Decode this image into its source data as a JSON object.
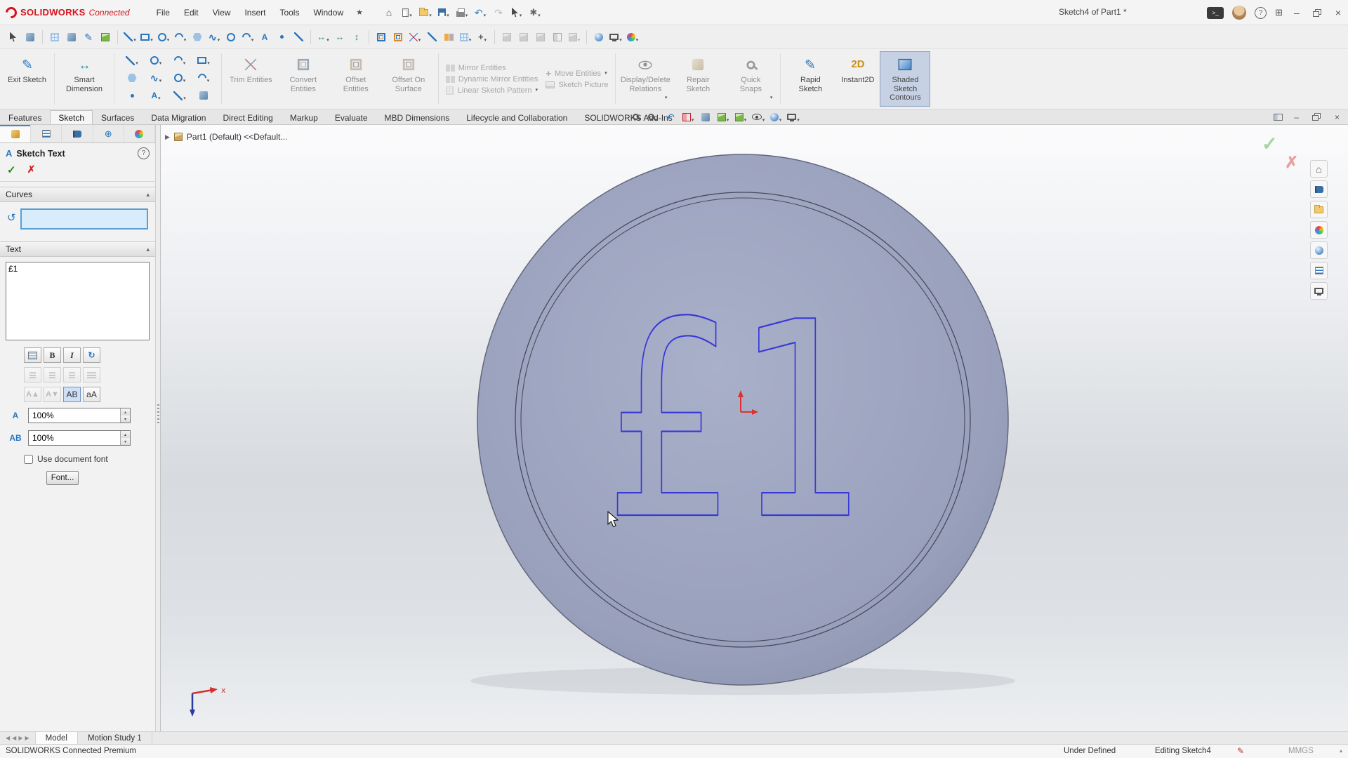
{
  "titlebar": {
    "logo_text": "SOLIDWORKS",
    "logo_sub": "Connected",
    "menus": [
      "File",
      "Edit",
      "View",
      "Insert",
      "Tools",
      "Window"
    ],
    "doc_title": "Sketch4 of Part1 *"
  },
  "icons": {
    "star": "★",
    "home": "⌂",
    "undo": "↶",
    "redo": "↷",
    "caret": "▾",
    "check": "✓",
    "cross": "✗",
    "help": "?",
    "minimize": "–",
    "close": "×",
    "terminal": ">_",
    "grid_view": "⊞",
    "chevron_up": "▴",
    "bold": "B",
    "italic": "I",
    "rotate": "↻",
    "curve": "↺",
    "width_factor": "A",
    "spacing": "AB",
    "ab_button": "AB",
    "aa_button": "aA",
    "pen": "✎",
    "flip_up": "A▲",
    "flip_down": "A▼",
    "breadcrumb_arrow": "▶",
    "tab_scroll_left": "◀",
    "tab_scroll_right": "▶",
    "spinner_up": "▴",
    "spinner_down": "▾",
    "pm_header": "A"
  },
  "icon_sets": {
    "titlebar_tools": [
      {
        "n": "home",
        "s": "home",
        "g": "⌂"
      },
      {
        "n": "new-document",
        "s": "newdoc",
        "c": true
      },
      {
        "n": "open",
        "s": "folder",
        "c": true
      },
      {
        "n": "save",
        "s": "save",
        "c": true
      },
      {
        "n": "print",
        "s": "print",
        "c": true
      },
      {
        "n": "undo",
        "s": "undo",
        "g": "↶",
        "c": true
      },
      {
        "n": "redo",
        "s": "redo",
        "g": "↷",
        "d": true
      },
      {
        "n": "select",
        "s": "cursor",
        "c": true
      },
      {
        "n": "settings",
        "s": "gear",
        "g": "✱",
        "c": true
      }
    ],
    "quickbar": [
      {
        "n": "select",
        "s": "cursor"
      },
      {
        "n": "lasso-select",
        "s": "generic"
      },
      "|",
      {
        "n": "grid-system",
        "s": "grid"
      },
      {
        "n": "reference-plane",
        "s": "generic"
      },
      {
        "n": "sketch",
        "s": "pencil",
        "g": "✎"
      },
      {
        "n": "3d-sketch",
        "s": "cube"
      },
      "|",
      {
        "n": "line",
        "s": "line",
        "c": true
      },
      {
        "n": "corner-rectangle",
        "s": "rect",
        "c": true
      },
      {
        "n": "circle",
        "s": "circle",
        "c": true
      },
      {
        "n": "centerpoint-arc",
        "s": "arc",
        "c": true
      },
      {
        "n": "polygon",
        "s": "poly"
      },
      {
        "n": "spline",
        "s": "spline",
        "g": "∿",
        "c": true
      },
      {
        "n": "ellipse",
        "s": "circle"
      },
      {
        "n": "sketch-fillet",
        "s": "arc",
        "c": true
      },
      {
        "n": "sketch-text",
        "s": "text",
        "g": "A"
      },
      {
        "n": "point",
        "s": "point"
      },
      {
        "n": "centerline",
        "s": "line"
      },
      "|",
      {
        "n": "smart-dimension",
        "s": "dim",
        "g": "↔",
        "c": true
      },
      {
        "n": "horizontal-dimension",
        "s": "dim",
        "g": "↔"
      },
      {
        "n": "vertical-dimension",
        "s": "dim",
        "g": "↕"
      },
      "|",
      {
        "n": "convert-entities",
        "s": "convert"
      },
      {
        "n": "offset-entities",
        "s": "offset"
      },
      {
        "n": "trim-entities",
        "s": "trim",
        "c": true
      },
      {
        "n": "extend-entities",
        "s": "line"
      },
      {
        "n": "mirror-entities",
        "s": "mirror"
      },
      {
        "n": "linear-sketch-pattern",
        "s": "grid",
        "c": true
      },
      {
        "n": "move-entities",
        "s": "move",
        "g": "+",
        "c": true
      },
      "|",
      {
        "n": "shaded-display",
        "s": "cube",
        "d": true
      },
      {
        "n": "hidden-lines-display",
        "s": "cube",
        "d": true
      },
      {
        "n": "wireframe-display",
        "s": "cube",
        "d": true
      },
      {
        "n": "section-view",
        "s": "section",
        "d": true
      },
      {
        "n": "view-orientation",
        "s": "cube",
        "d": true,
        "c": true
      },
      "|",
      {
        "n": "appearances",
        "s": "sphere"
      },
      {
        "n": "apply-scene",
        "s": "monitor",
        "c": true
      },
      {
        "n": "view-settings",
        "s": "palette",
        "c": true
      }
    ],
    "entity_grid": [
      {
        "n": "line",
        "s": "line",
        "c": true
      },
      {
        "n": "circle",
        "s": "circle",
        "c": true
      },
      {
        "n": "arc",
        "s": "arc",
        "c": true
      },
      {
        "n": "rectangle",
        "s": "rect",
        "c": true
      },
      {
        "n": "polygon",
        "s": "poly"
      },
      {
        "n": "spline",
        "s": "spline",
        "g": "∿",
        "c": true
      },
      {
        "n": "ellipse",
        "s": "circle",
        "c": true
      },
      {
        "n": "fillet",
        "s": "arc",
        "c": true
      },
      {
        "n": "point",
        "s": "point"
      },
      {
        "n": "text",
        "s": "text",
        "g": "A",
        "c": true
      },
      {
        "n": "centerline",
        "s": "line",
        "c": true
      },
      {
        "n": "construction-geometry",
        "s": "generic"
      }
    ],
    "hud": [
      {
        "n": "zoom-to-fit",
        "s": "mag"
      },
      {
        "n": "zoom-to-area",
        "s": "mag",
        "c": true
      },
      {
        "n": "previous-view",
        "s": "undo",
        "g": "↶"
      },
      {
        "n": "section-view",
        "s": "section",
        "c": true
      },
      {
        "n": "dynamic-annotation-views",
        "s": "generic"
      },
      {
        "n": "view-orientation",
        "s": "cube",
        "c": true
      },
      {
        "n": "display-style",
        "s": "cube",
        "c": true
      },
      {
        "n": "hide-show-items",
        "s": "eye",
        "c": true
      },
      {
        "n": "edit-appearance",
        "s": "sphere",
        "c": true
      },
      {
        "n": "apply-scene",
        "s": "monitor",
        "c": true
      }
    ],
    "taskpane": [
      {
        "n": "solidworks-resources",
        "s": "home",
        "g": "⌂"
      },
      {
        "n": "design-library",
        "s": "book"
      },
      {
        "n": "file-explorer",
        "s": "folder"
      },
      {
        "n": "view-palette",
        "s": "palette"
      },
      {
        "n": "appearances-scenes",
        "s": "sphere"
      },
      {
        "n": "custom-properties",
        "s": "list"
      },
      {
        "n": "screen-capture",
        "s": "monitor"
      }
    ],
    "pm_tabs": [
      {
        "n": "featuremanager-tab",
        "s": "orange"
      },
      {
        "n": "propertymanager-tab",
        "s": "list"
      },
      {
        "n": "configurationmanager-tab",
        "s": "book"
      },
      {
        "n": "dimxpertmanager-tab",
        "s": "target",
        "g": "⊕"
      },
      {
        "n": "displaymanager-tab",
        "s": "palette"
      }
    ]
  },
  "ribbon": {
    "exit_sketch": "Exit Sketch",
    "smart_dimension": "Smart Dimension",
    "trim_entities": "Trim Entities",
    "convert_entities": "Convert Entities",
    "offset_entities": "Offset Entities",
    "offset_on_surface": "Offset On Surface",
    "mirror_entities": "Mirror Entities",
    "dynamic_mirror": "Dynamic Mirror Entities",
    "linear_pattern": "Linear Sketch Pattern",
    "move_entities": "Move Entities",
    "sketch_picture": "Sketch Picture",
    "display_delete_relations": "Display/Delete Relations",
    "repair_sketch": "Repair Sketch",
    "quick_snaps": "Quick Snaps",
    "rapid_sketch": "Rapid Sketch",
    "instant2d": "Instant2D",
    "shaded_contours": "Shaded Sketch Contours"
  },
  "cm_tabs": [
    "Features",
    "Sketch",
    "Surfaces",
    "Data Migration",
    "Direct Editing",
    "Markup",
    "Evaluate",
    "MBD Dimensions",
    "Lifecycle and Collaboration",
    "SOLIDWORKS Add-Ins"
  ],
  "property_panel": {
    "title": "Sketch Text",
    "curves_label": "Curves",
    "text_label": "Text",
    "text_value": "£1",
    "width_factor": "100%",
    "spacing": "100%",
    "use_document_font": "Use document font",
    "font_button": "Font..."
  },
  "viewport": {
    "breadcrumb": "Part1 (Default) <<Default...",
    "sketch_text": "£1",
    "triad_x_label": "x"
  },
  "bottom_tabs": [
    "Model",
    "Motion Study 1"
  ],
  "statusbar": {
    "app": "SOLIDWORKS Connected Premium",
    "constraint": "Under Defined",
    "editing": "Editing Sketch4",
    "units": "MMGS"
  },
  "colors": {
    "logo_red": "#d6121b",
    "sketch_blue": "#3838d8",
    "coin_face": "#9aa1bd",
    "check_green": "#1c8c1c",
    "cross_red": "#cc2a2a"
  }
}
